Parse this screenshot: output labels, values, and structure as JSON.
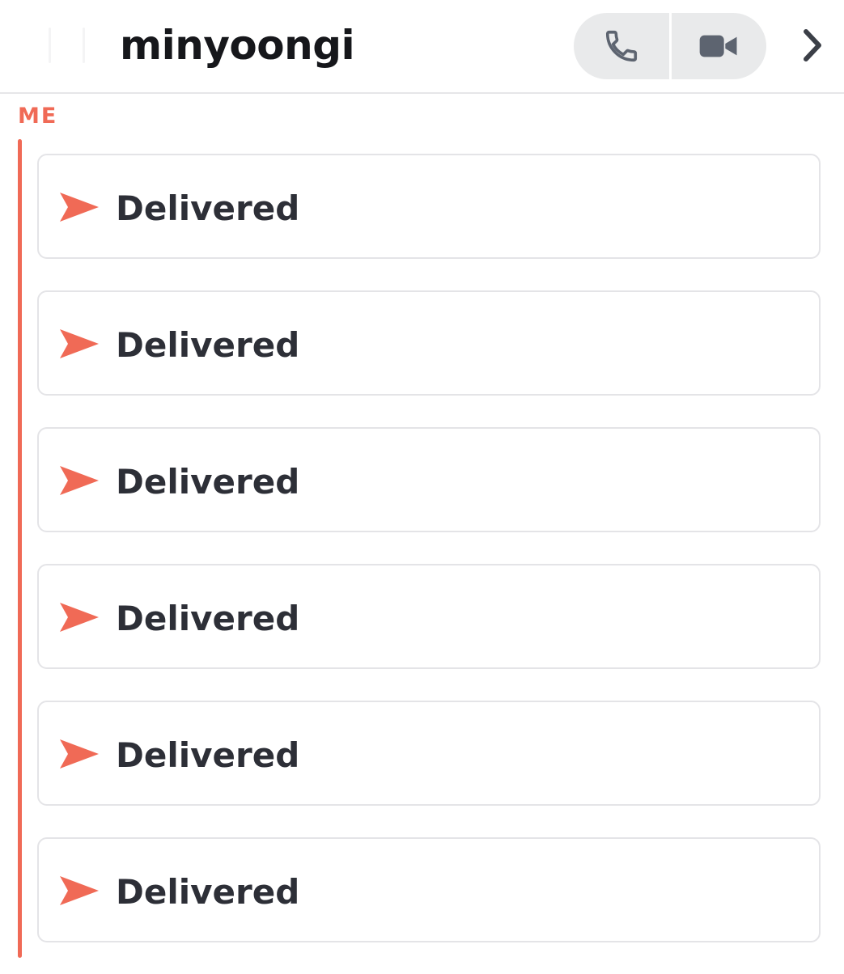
{
  "header": {
    "title": "minyoongi",
    "call_icon": "phone-icon",
    "video_icon": "video-camera-icon",
    "more_icon": "chevron-right-icon"
  },
  "thread": {
    "sender": "ME",
    "accent_color": "#f06a56",
    "messages": [
      {
        "status": "Delivered",
        "icon": "sent-arrow-icon"
      },
      {
        "status": "Delivered",
        "icon": "sent-arrow-icon"
      },
      {
        "status": "Delivered",
        "icon": "sent-arrow-icon"
      },
      {
        "status": "Delivered",
        "icon": "sent-arrow-icon"
      },
      {
        "status": "Delivered",
        "icon": "sent-arrow-icon"
      },
      {
        "status": "Delivered",
        "icon": "sent-arrow-icon"
      }
    ]
  }
}
